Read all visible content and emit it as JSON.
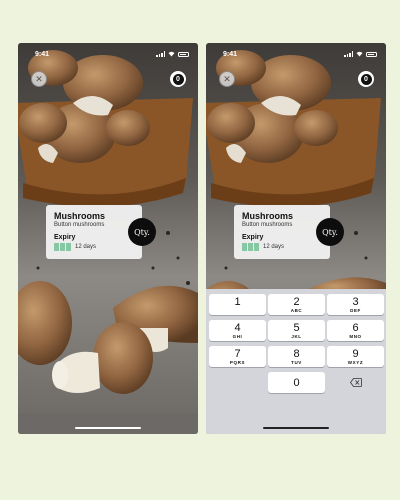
{
  "status_bar": {
    "time": "9:41"
  },
  "header": {
    "close_icon": "close-icon",
    "item_count": "0"
  },
  "item_card": {
    "title": "Mushrooms",
    "subtitle": "Button mushrooms",
    "expiry_label": "Expiry",
    "expiry_days": "12 days"
  },
  "qty_button": {
    "label": "Qty."
  },
  "keypad": {
    "keys": [
      {
        "digit": "1",
        "letters": ""
      },
      {
        "digit": "2",
        "letters": "ABC"
      },
      {
        "digit": "3",
        "letters": "DEF"
      },
      {
        "digit": "4",
        "letters": "GHI"
      },
      {
        "digit": "5",
        "letters": "JKL"
      },
      {
        "digit": "6",
        "letters": "MNO"
      },
      {
        "digit": "7",
        "letters": "PQRS"
      },
      {
        "digit": "8",
        "letters": "TUV"
      },
      {
        "digit": "9",
        "letters": "WXYZ"
      },
      {
        "digit": "0",
        "letters": ""
      }
    ],
    "backspace_icon": "backspace-icon"
  },
  "colors": {
    "page_background": "#edf3dc",
    "expiry_bar": "#86c7a4",
    "qty_button": "#0d0d0d",
    "keypad_background": "#d3d5db"
  }
}
